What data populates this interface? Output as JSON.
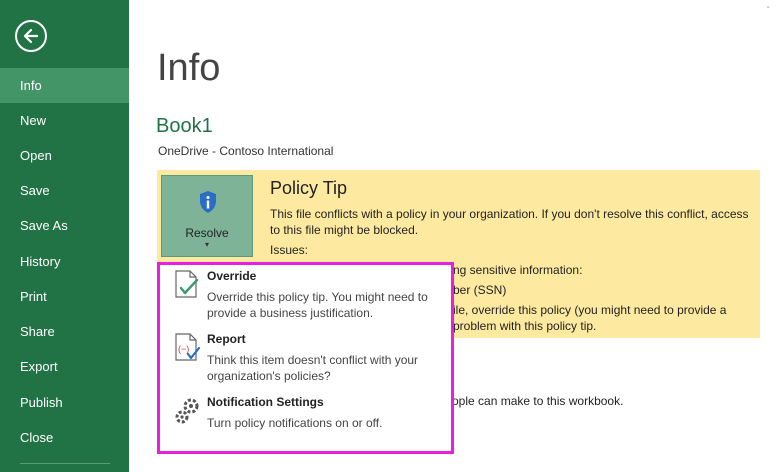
{
  "sidebar": {
    "items": [
      {
        "label": "Info",
        "active": true
      },
      {
        "label": "New"
      },
      {
        "label": "Open"
      },
      {
        "label": "Save"
      },
      {
        "label": "Save As"
      },
      {
        "label": "History"
      },
      {
        "label": "Print"
      },
      {
        "label": "Share"
      },
      {
        "label": "Export"
      },
      {
        "label": "Publish"
      },
      {
        "label": "Close"
      }
    ]
  },
  "main": {
    "page_title": "Info",
    "doc_title": "Book1",
    "doc_location": "OneDrive - Contoso International",
    "top_mark": "-"
  },
  "policy_tip": {
    "resolve_label": "Resolve",
    "resolve_caret": "▾",
    "title": "Policy Tip",
    "text": "This file conflicts with a policy in your organization. If you don't resolve this conflict, access to this file might be blocked.",
    "issues_label": "Issues:",
    "issue_fragment_1": "ng sensitive information:",
    "issue_fragment_2": "ber (SSN)",
    "issue_fragment_3": "ile, override this policy (you might need to provide a",
    "issue_fragment_4": "problem with this policy tip."
  },
  "permissions_fragment": "ople can make to this workbook.",
  "popup_menu": {
    "override": {
      "title": "Override",
      "desc": "Override this policy tip. You might need to provide a business justification."
    },
    "report": {
      "title": "Report",
      "desc": "Think this item doesn't conflict with your organization's policies?"
    },
    "notification_settings": {
      "title": "Notification Settings",
      "desc": "Turn policy notifications on or off."
    }
  },
  "colors": {
    "sidebar": "#217346",
    "sidebar_active": "#439467",
    "banner": "#fdeaa0",
    "popup_border": "#e81ee0",
    "accent_green": "#217346"
  }
}
